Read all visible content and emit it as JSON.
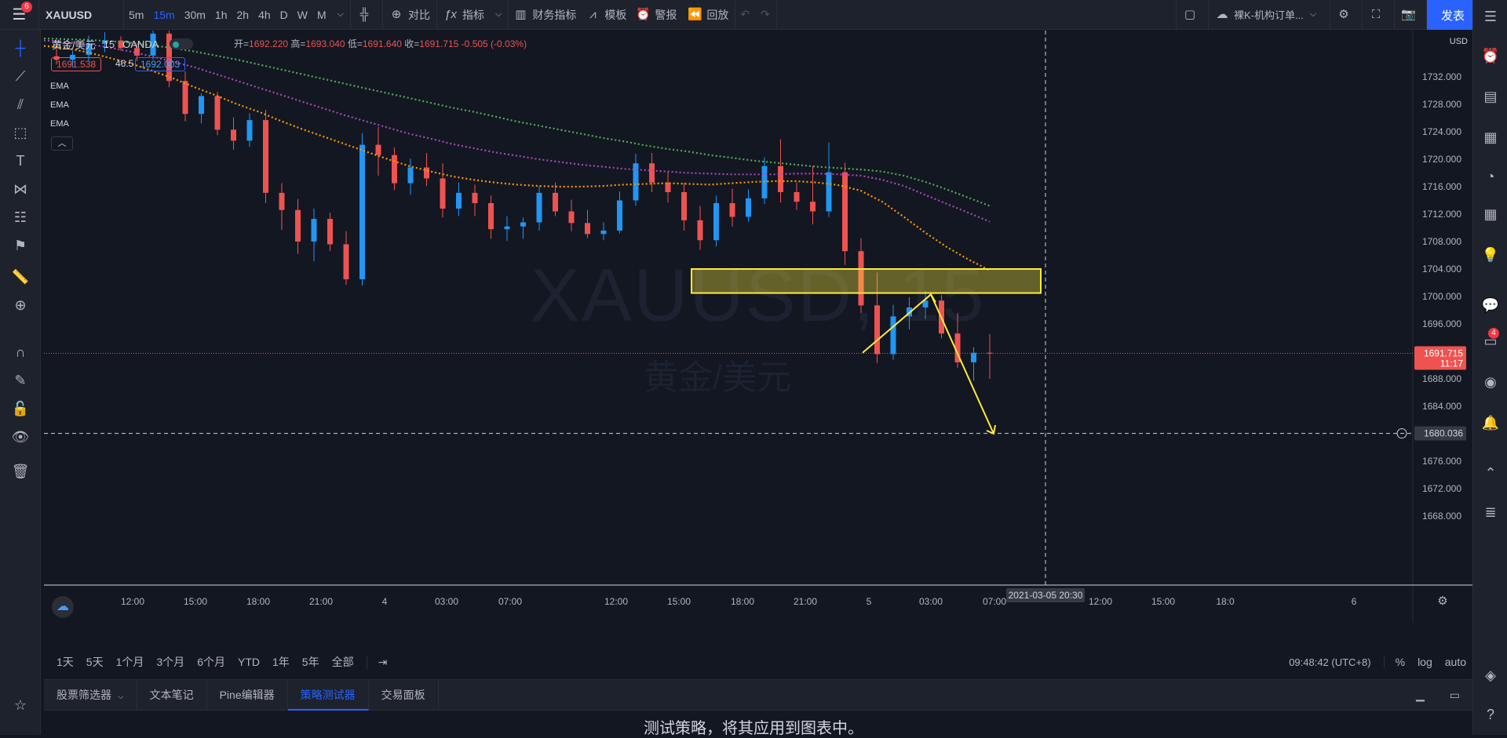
{
  "topbar": {
    "menu_badge": "6",
    "symbol": "XAUUSD",
    "intervals": [
      "5m",
      "15m",
      "30m",
      "1h",
      "2h",
      "4h",
      "D",
      "W",
      "M"
    ],
    "active_interval": "15m",
    "compare": "对比",
    "indicators": "指标",
    "financials": "财务指标",
    "templates": "模板",
    "alerts": "警报",
    "replay": "回放",
    "layout_name": "裸K-机构订单...",
    "publish": "发表"
  },
  "legend": {
    "title": "黄金/美元",
    "interval": "15",
    "exchange": "OANDA",
    "open_label": "开=",
    "open": "1692.220",
    "high_label": "高=",
    "high": "1693.040",
    "low_label": "低=",
    "low": "1691.640",
    "close_label": "收=",
    "close": "1691.715",
    "change": "-0.505 (-0.03%)",
    "bid": "1691.538",
    "spread": "46.5",
    "ask": "1692.003",
    "ema_labels": [
      "EMA",
      "EMA",
      "EMA"
    ]
  },
  "watermark": {
    "symbol": "XAUUSD, 15",
    "name": "黄金/美元"
  },
  "price_axis": {
    "currency": "USD",
    "ticks": [
      "1732.000",
      "1728.000",
      "1724.000",
      "1720.000",
      "1716.000",
      "1712.000",
      "1708.000",
      "1704.000",
      "1700.000",
      "1696.000",
      "1692.000",
      "1688.000",
      "1684.000",
      "1680.000",
      "1676.000",
      "1672.000",
      "1668.000"
    ],
    "last_price": "1691.715",
    "countdown": "11:17",
    "crosshair_price": "1680.036"
  },
  "time_axis": {
    "ticks": [
      "12:00",
      "15:00",
      "18:00",
      "21:00",
      "4",
      "03:00",
      "07:00",
      "12:00",
      "15:00",
      "18:00",
      "21:00",
      "5",
      "03:00",
      "07:00",
      "12:00",
      "15:00",
      "18:0",
      "6"
    ],
    "crosshair_date": "2021-03-05",
    "crosshair_time": "20:30"
  },
  "range_bar": {
    "ranges": [
      "1天",
      "5天",
      "1个月",
      "3个月",
      "6个月",
      "YTD",
      "1年",
      "5年",
      "全部"
    ],
    "clock": "09:48:42 (UTC+8)",
    "percent": "%",
    "log": "log",
    "auto": "auto"
  },
  "bottom_tabs": [
    "股票筛选器",
    "文本笔记",
    "Pine编辑器",
    "策略测试器",
    "交易面板"
  ],
  "active_bottom_tab": "策略测试器",
  "bottom_message": "测试策略，将其应用到图表中。",
  "right_toolbar": {
    "chat_badge": "4"
  },
  "colors": {
    "background": "#131722",
    "panel": "#1e222d",
    "up": "#2196f3",
    "down": "#ef5350",
    "ema_green": "#4caf50",
    "ema_purple": "#ab47bc",
    "ema_orange": "#ff9800",
    "zone": "#ffeb3b",
    "accent": "#2962ff"
  },
  "chart_data": {
    "type": "candlestick",
    "symbol": "XAUUSD",
    "interval": "15",
    "ylim": [
      1666,
      1738
    ],
    "last_price": 1691.715,
    "zone": {
      "from": 1700.5,
      "to": 1704.0
    },
    "projection": [
      1691.8,
      1700.3,
      1680.0
    ],
    "ema_fast": [
      1736.5,
      1736.2,
      1735.6,
      1734.8,
      1734.0,
      1732.9,
      1731.8,
      1730.5,
      1729.3,
      1728.0,
      1726.9,
      1725.6,
      1724.4,
      1723.3,
      1722.2,
      1721.1,
      1720.0,
      1719.0,
      1718.2,
      1717.5,
      1717.0,
      1716.6,
      1716.3,
      1716.1,
      1716.0,
      1716.0,
      1716.1,
      1716.3,
      1716.4,
      1716.5,
      1716.4,
      1716.3,
      1716.5,
      1716.7,
      1716.8,
      1716.8,
      1716.6,
      1716.2,
      1715.4,
      1713.8,
      1711.6,
      1709.3,
      1707.2,
      1705.4,
      1703.8
    ],
    "ema_mid": [
      1737.3,
      1737.1,
      1736.8,
      1736.3,
      1735.7,
      1735.0,
      1734.2,
      1733.4,
      1732.4,
      1731.4,
      1730.4,
      1729.4,
      1728.4,
      1727.4,
      1726.4,
      1725.5,
      1724.6,
      1723.7,
      1723.0,
      1722.2,
      1721.6,
      1721.0,
      1720.5,
      1720.0,
      1719.6,
      1719.2,
      1718.9,
      1718.6,
      1718.4,
      1718.2,
      1718.0,
      1717.9,
      1717.8,
      1717.8,
      1717.8,
      1717.9,
      1717.9,
      1717.8,
      1717.6,
      1717.0,
      1716.1,
      1714.8,
      1713.5,
      1712.2,
      1710.9
    ],
    "ema_slow": [
      1737.6,
      1737.5,
      1737.4,
      1737.2,
      1737.0,
      1736.6,
      1736.2,
      1735.7,
      1735.1,
      1734.5,
      1733.8,
      1733.1,
      1732.4,
      1731.7,
      1731.0,
      1730.3,
      1729.6,
      1728.9,
      1728.2,
      1727.5,
      1726.9,
      1726.2,
      1725.5,
      1724.9,
      1724.3,
      1723.7,
      1723.1,
      1722.6,
      1722.0,
      1721.5,
      1721.1,
      1720.6,
      1720.2,
      1719.8,
      1719.5,
      1719.2,
      1718.9,
      1718.7,
      1718.5,
      1718.2,
      1717.6,
      1716.7,
      1715.6,
      1714.4,
      1713.2
    ],
    "candles": [
      [
        1735,
        1736.5,
        1733.8,
        1734.5
      ],
      [
        1734.5,
        1735.8,
        1733.4,
        1735.2
      ],
      [
        1735.2,
        1738,
        1734.3,
        1736.8
      ],
      [
        1736.8,
        1738.5,
        1735.6,
        1737.3
      ],
      [
        1737.3,
        1737.9,
        1735.8,
        1736.2
      ],
      [
        1736.2,
        1736.9,
        1734.3,
        1735.1
      ],
      [
        1735.1,
        1739,
        1734.5,
        1738.3
      ],
      [
        1738.3,
        1739.4,
        1730.5,
        1731.4
      ],
      [
        1731.4,
        1732.8,
        1725.5,
        1726.6
      ],
      [
        1726.6,
        1729.6,
        1725.2,
        1729.2
      ],
      [
        1729.2,
        1729.8,
        1723.5,
        1724.3
      ],
      [
        1724.3,
        1726.1,
        1721.4,
        1722.7
      ],
      [
        1722.7,
        1726.7,
        1721.8,
        1725.7
      ],
      [
        1725.7,
        1727.2,
        1713.6,
        1715.1
      ],
      [
        1715.1,
        1716.5,
        1709.7,
        1712.6
      ],
      [
        1712.6,
        1714.2,
        1706.2,
        1708.0
      ],
      [
        1708.0,
        1712.8,
        1705.1,
        1711.3
      ],
      [
        1711.3,
        1712.2,
        1706.6,
        1707.6
      ],
      [
        1707.6,
        1709.5,
        1701.7,
        1702.5
      ],
      [
        1702.5,
        1723.8,
        1701.6,
        1722.1
      ],
      [
        1722.1,
        1724.7,
        1717.6,
        1720.6
      ],
      [
        1720.6,
        1721.7,
        1715.5,
        1716.5
      ],
      [
        1716.5,
        1720.1,
        1714.8,
        1718.8
      ],
      [
        1718.8,
        1720.9,
        1716.1,
        1717.2
      ],
      [
        1717.2,
        1719.4,
        1711.5,
        1712.8
      ],
      [
        1712.8,
        1716.6,
        1711.7,
        1715.1
      ],
      [
        1715.1,
        1716.3,
        1711.7,
        1713.6
      ],
      [
        1713.6,
        1714.7,
        1708.4,
        1709.8
      ],
      [
        1709.8,
        1711.7,
        1708.1,
        1710.2
      ],
      [
        1710.2,
        1711.5,
        1708.4,
        1710.8
      ],
      [
        1710.8,
        1716.1,
        1709.6,
        1715.1
      ],
      [
        1715.1,
        1716.6,
        1711.7,
        1712.4
      ],
      [
        1712.4,
        1714.1,
        1709.5,
        1710.7
      ],
      [
        1710.7,
        1712.6,
        1708.5,
        1709.1
      ],
      [
        1709.1,
        1710.8,
        1708.2,
        1709.6
      ],
      [
        1709.6,
        1715.3,
        1709.2,
        1714.0
      ],
      [
        1714.0,
        1720.8,
        1713.2,
        1719.4
      ],
      [
        1719.4,
        1720.9,
        1715.2,
        1716.6
      ],
      [
        1716.6,
        1718.1,
        1713.7,
        1715.2
      ],
      [
        1715.2,
        1716.6,
        1709.6,
        1711.1
      ],
      [
        1711.1,
        1713.2,
        1706.8,
        1708.2
      ],
      [
        1708.2,
        1714.7,
        1707.3,
        1713.6
      ],
      [
        1713.6,
        1715.7,
        1710.2,
        1711.6
      ],
      [
        1711.6,
        1715.6,
        1710.9,
        1714.3
      ],
      [
        1714.3,
        1720.3,
        1713.5,
        1719.0
      ],
      [
        1719.0,
        1722.9,
        1713.7,
        1715.2
      ],
      [
        1715.2,
        1716.6,
        1712.6,
        1713.8
      ],
      [
        1713.8,
        1719.0,
        1710.5,
        1712.4
      ],
      [
        1712.4,
        1722.4,
        1711.6,
        1718.1
      ],
      [
        1718.1,
        1719.5,
        1704.6,
        1706.6
      ],
      [
        1706.6,
        1708.5,
        1697.6,
        1698.7
      ],
      [
        1698.7,
        1703.5,
        1690.3,
        1691.6
      ],
      [
        1691.6,
        1698.8,
        1690.8,
        1697.1
      ],
      [
        1697.1,
        1699.9,
        1695.2,
        1698.4
      ],
      [
        1698.4,
        1700.8,
        1696.7,
        1699.4
      ],
      [
        1699.4,
        1700.2,
        1693.9,
        1694.6
      ],
      [
        1694.6,
        1697.6,
        1689.6,
        1690.4
      ],
      [
        1690.4,
        1692.6,
        1687.7,
        1691.8
      ],
      [
        1691.8,
        1694.5,
        1688.0,
        1691.7
      ]
    ]
  }
}
